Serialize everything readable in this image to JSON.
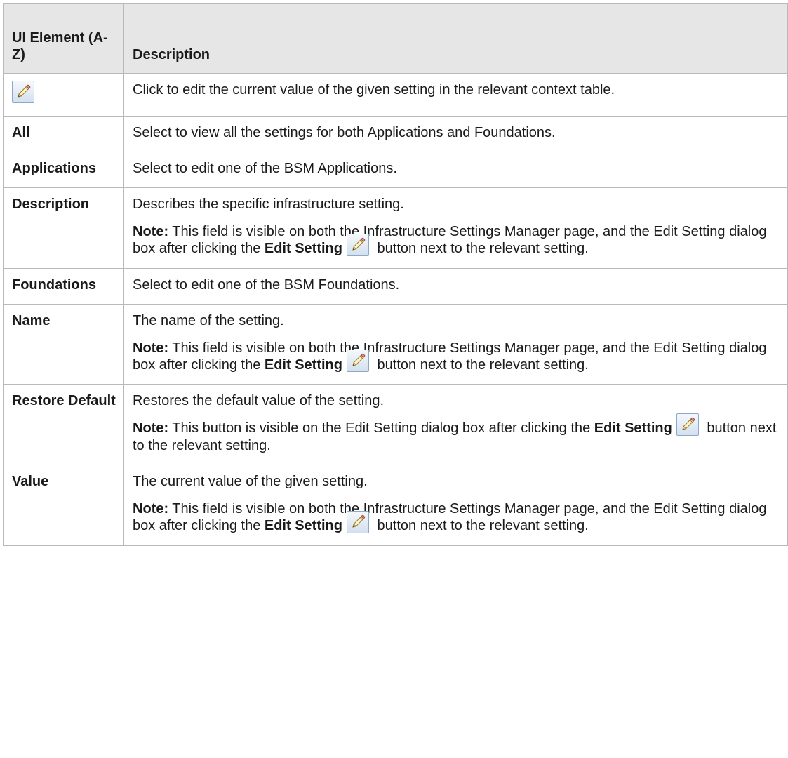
{
  "header": {
    "col1": "UI Element (A-Z)",
    "col2": "Description"
  },
  "rows": [
    {
      "icon": "edit-pencil-icon",
      "desc": "Click to edit the current value of the given setting in the relevant context table."
    },
    {
      "element": "All",
      "desc": "Select to view all the settings for both Applications and Foundations."
    },
    {
      "element": "Applications",
      "desc": "Select to edit one of the BSM Applications."
    },
    {
      "element": "Description",
      "desc": "Describes the specific infrastructure setting.",
      "note_label": "Note:",
      "note_text": " This field is visible on both the Infrastructure Settings Manager page, and the Edit Setting dialog box after clicking the ",
      "note_bold": "Edit Setting",
      "note_end": " button next to the relevant setting."
    },
    {
      "element": "Foundations",
      "desc": "Select to edit one of the BSM Foundations."
    },
    {
      "element": "Name",
      "desc": "The name of the setting.",
      "note_label": "Note:",
      "note_text": " This field is visible on both the Infrastructure Settings Manager page, and the Edit Setting dialog box after clicking the ",
      "note_bold": "Edit Setting",
      "note_end": " button next to the relevant setting."
    },
    {
      "element": "Restore Default",
      "desc": "Restores the default value of the setting.",
      "note_label": "Note:",
      "note_text": " This button is visible on the Edit Setting dialog box after clicking the ",
      "note_bold": "Edit Setting",
      "note_end": " button next to the relevant setting."
    },
    {
      "element": "Value",
      "desc": "The current value of the given setting.",
      "note_label": "Note:",
      "note_text": " This field is visible on both the Infrastructure Settings Manager page, and the Edit Setting dialog box after clicking the ",
      "note_bold": "Edit Setting",
      "note_end": " button next to the relevant setting."
    }
  ],
  "colors": {
    "header_bg": "#e6e6e6",
    "border": "#b9b9b9",
    "icon_border": "#8ea9c8"
  }
}
